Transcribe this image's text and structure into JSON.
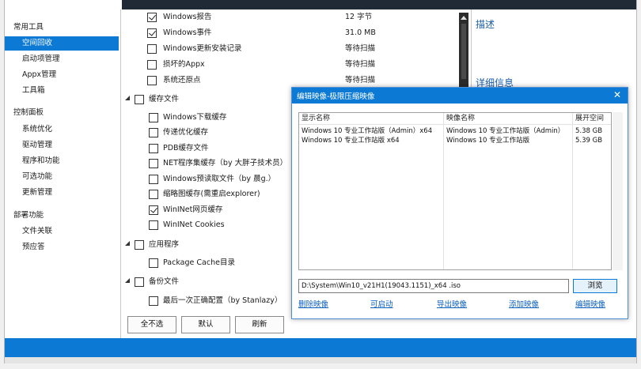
{
  "sidebar": {
    "groups": [
      "常用工具",
      "控制面板",
      "部署功能"
    ],
    "items_common": [
      "空间回收",
      "启动项管理",
      "Appx管理",
      "工具箱"
    ],
    "items_control": [
      "系统优化",
      "驱动管理",
      "程序和功能",
      "可选功能",
      "更新管理"
    ],
    "items_deploy": [
      "文件关联",
      "预应答"
    ]
  },
  "main": {
    "top_items": [
      {
        "label": "Windows报告",
        "size": "12 字节",
        "checked": true
      },
      {
        "label": "Windows事件",
        "size": "31.0 MB",
        "checked": true
      },
      {
        "label": "Windows更新安装记录",
        "size": "等待扫描",
        "checked": false
      },
      {
        "label": "损坏的Appx",
        "size": "等待扫描",
        "checked": false
      },
      {
        "label": "系统还原点",
        "size": "等待扫描",
        "checked": false
      }
    ],
    "cache_group": "缓存文件",
    "cache_items": [
      {
        "label": "Windows下载缓存",
        "checked": false
      },
      {
        "label": "传递优化缓存",
        "checked": false
      },
      {
        "label": "PDB缓存文件",
        "checked": false
      },
      {
        "label": "NET程序集缓存（by 大胖子技术员）",
        "checked": false
      },
      {
        "label": "Windows预读取文件（by 晨g.）",
        "checked": false
      },
      {
        "label": "缩略图缓存(需重启explorer)",
        "checked": false
      },
      {
        "label": "WinINet网页缓存",
        "checked": true
      },
      {
        "label": "WinINet Cookies",
        "checked": false
      }
    ],
    "app_group": "应用程序",
    "app_items": [
      {
        "label": "Package Cache目录",
        "checked": false
      }
    ],
    "backup_group": "备份文件",
    "backup_items": [
      {
        "label": "最后一次正确配置（by Stanlazy）",
        "checked": false
      }
    ],
    "buttons": {
      "select_none": "全不选",
      "default": "默认",
      "refresh": "刷新"
    }
  },
  "right_pane": {
    "description_title": "描述",
    "details_title": "详细信息"
  },
  "dialog": {
    "title": "编辑映像-极限压缩映像",
    "close": "✕",
    "columns": [
      "显示名称",
      "映像名称",
      "展开空间"
    ],
    "rows": [
      [
        "Windows 10 专业工作站版（Admin）x64",
        "Windows 10 专业工作站版（Admin）",
        "5.38 GB"
      ],
      [
        "Windows 10 专业工作站版 x64",
        "Windows 10 专业工作站版",
        "5.39 GB"
      ]
    ],
    "path": "D:\\System\\Win10_v21H1(19043.1151)_x64 .iso",
    "browse": "浏览",
    "actions": [
      "删除映像",
      "可启动",
      "导出映像",
      "添加映像",
      "编辑映像"
    ]
  }
}
